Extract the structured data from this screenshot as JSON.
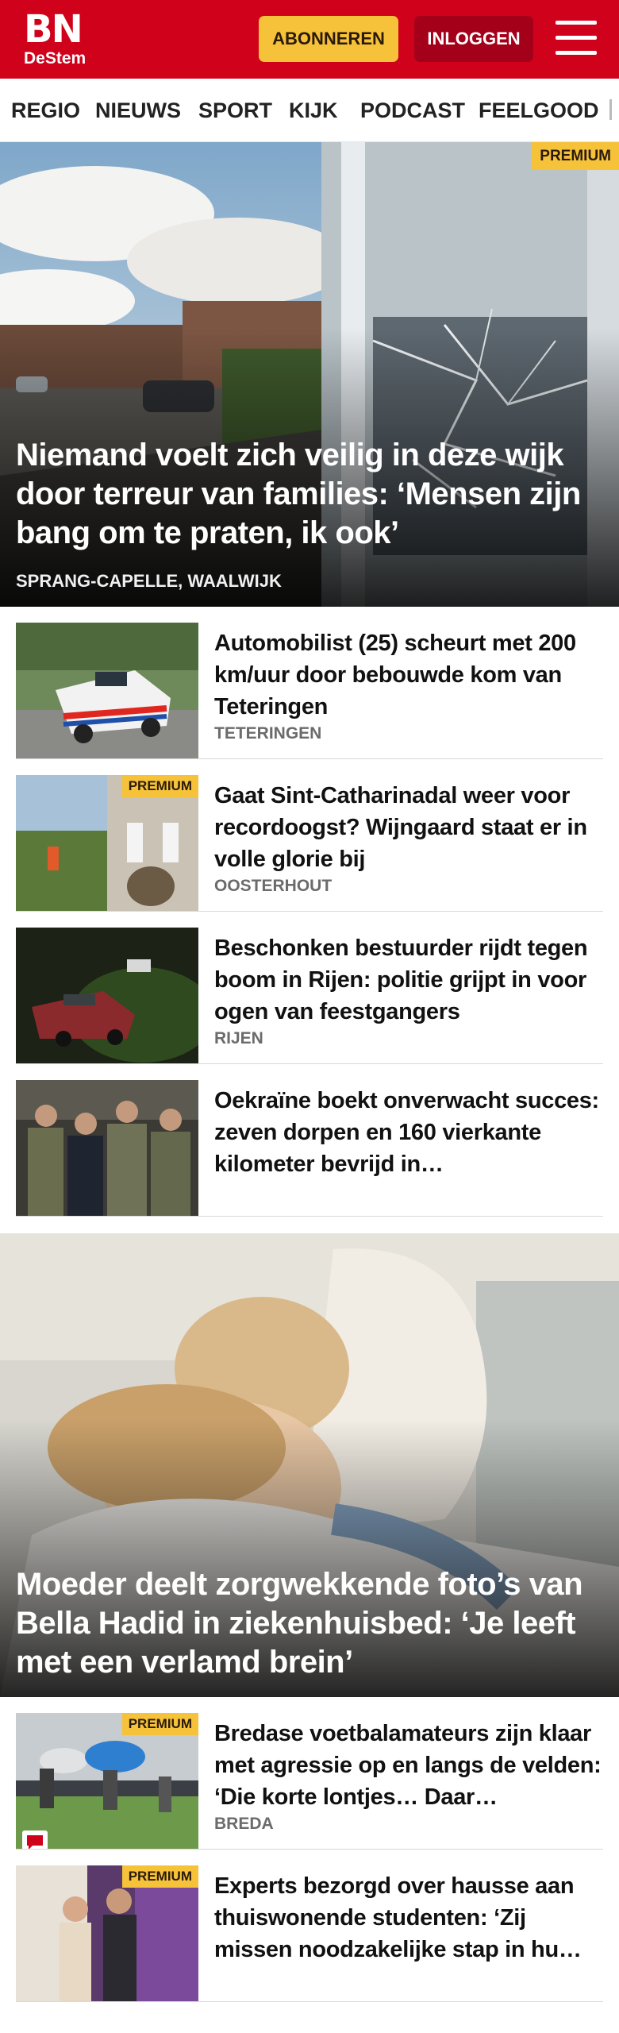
{
  "header": {
    "logo_main": "BN",
    "logo_sub": "DeStem",
    "subscribe_label": "ABONNEREN",
    "login_label": "INLOGGEN",
    "brand_color": "#d0021b",
    "accent_color": "#f5c23a"
  },
  "nav": {
    "items": [
      "REGIO",
      "NIEUWS",
      "SPORT",
      "KIJK",
      "PODCAST",
      "FEELGOOD"
    ]
  },
  "hero": {
    "badge": "PREMIUM",
    "title": "Niemand voelt zich veilig in deze wijk door terreur van families: ‘Mensen zijn bang om te praten, ik ook’",
    "location": "SPRANG-CAPELLE, WAALWIJK"
  },
  "articles": [
    {
      "title": "Automobilist (25) scheurt met 200 km/uur door bebouwde kom van Teteringen",
      "location": "TETERINGEN"
    },
    {
      "badge": "PREMIUM",
      "title": "Gaat Sint-Catharinadal weer voor recordoogst? Wijngaard staat er in volle glorie bij",
      "location": "OOSTERHOUT"
    },
    {
      "title": "Beschonken bestuurder rijdt tegen boom in Rijen: politie grijpt in voor ogen van feestgangers",
      "location": "RIJEN"
    },
    {
      "title": "Oekraïne boekt onverwacht succes: zeven dorpen en 160 vierkante kilometer bevrijd in…",
      "location": ""
    }
  ],
  "feature": {
    "title": "Moeder deelt zorgwekkende foto’s van Bella Hadid in ziekenhuisbed: ‘Je leeft met een verlamd brein’"
  },
  "articles2": [
    {
      "badge": "PREMIUM",
      "title": "Bredase voetbalamateurs zijn klaar met agressie op en langs de velden: ‘Die korte lontjes… Daar…",
      "location": "BREDA"
    },
    {
      "badge": "PREMIUM",
      "title": "Experts bezorgd over hausse aan thuiswonende studenten: ‘Zij missen noodzakelijke stap in hu…",
      "location": ""
    }
  ]
}
